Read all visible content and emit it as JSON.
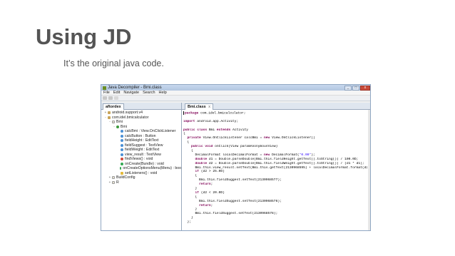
{
  "slide": {
    "title": "Using JD",
    "subtitle": "It’s the original java code."
  },
  "window": {
    "title": "Java Decompiler - Bmi.class",
    "controls": [
      "_",
      "□",
      "x"
    ],
    "menu": [
      "File",
      "Edit",
      "Navigate",
      "Search",
      "Help"
    ],
    "left_tab": "aftordex",
    "right_tab": "Bmi.class",
    "close_glyph": "x"
  },
  "tree": [
    {
      "toggle": "+",
      "indent": 0,
      "icon": "pkg",
      "label": "android.support.v4"
    },
    {
      "toggle": "-",
      "indent": 0,
      "icon": "pkg",
      "label": "com.idel.bmicalculator"
    },
    {
      "toggle": "-",
      "indent": 1,
      "icon": "file",
      "label": "Bmi"
    },
    {
      "toggle": "-",
      "indent": 2,
      "icon": "cls",
      "label": "Bmi"
    },
    {
      "toggle": "",
      "indent": 3,
      "icon": "fld",
      "label": "calcBmi : View.OnClickListener"
    },
    {
      "toggle": "",
      "indent": 3,
      "icon": "fld",
      "label": "calcButton : Button"
    },
    {
      "toggle": "",
      "indent": 3,
      "icon": "fld",
      "label": "fieldHeight : EditText"
    },
    {
      "toggle": "",
      "indent": 3,
      "icon": "fld",
      "label": "fieldSuggest : TextView"
    },
    {
      "toggle": "",
      "indent": 3,
      "icon": "fld",
      "label": "fieldWeight : EditText"
    },
    {
      "toggle": "",
      "indent": 3,
      "icon": "fld",
      "label": "view_result : TextView"
    },
    {
      "toggle": "",
      "indent": 3,
      "icon": "prv",
      "label": "findViews() : void"
    },
    {
      "toggle": "",
      "indent": 3,
      "icon": "mth",
      "label": "onCreate(Bundle) : void"
    },
    {
      "toggle": "",
      "indent": 3,
      "icon": "mth",
      "label": "onCreateOptionsMenu(Menu) : boo"
    },
    {
      "toggle": "",
      "indent": 3,
      "icon": "prt",
      "label": "setListeners() : void"
    },
    {
      "toggle": "+",
      "indent": 1,
      "icon": "file",
      "label": "BuildConfig"
    },
    {
      "toggle": "+",
      "indent": 1,
      "icon": "file",
      "label": "R"
    }
  ],
  "code_lines": [
    "package com.idel.bmicalculator;",
    "",
    "import android.app.Activity;",
    "",
    "public class Bmi extends Activity",
    "{",
    "  private View.OnClickListener calcBmi = new View.OnClickListener()",
    "  {",
    "    public void onClick(View paramAnonymousView)",
    "    {",
    "      DecimalFormat localDecimalFormat = new DecimalFormat(\"0.00\");",
    "      double d1 = Double.parseDouble(Bmi.this.fieldHeight.getText().toString()) / 100.0D;",
    "      double d2 = Double.parseDouble(Bmi.this.fieldWeight.getText().toString()) / (d1 * d1);",
    "      Bmi.this.view_result.setText(Bmi.this.getText(2130968595) + localDecimalFormat.format(d2));",
    "      if (d2 > 25.0D)",
    "      {",
    "        Bmi.this.fieldSuggest.setText(2130968577);",
    "        return;",
    "      }",
    "      if (d2 < 20.0D)",
    "      {",
    "        Bmi.this.fieldSuggest.setText(2130968576);",
    "        return;",
    "      }",
    "      Bmi.this.fieldSuggest.setText(2130968578);",
    "    }",
    "  };"
  ],
  "colors": {
    "keyword": "#7f0055",
    "string": "#2a00ff",
    "title_text": "#545454"
  }
}
